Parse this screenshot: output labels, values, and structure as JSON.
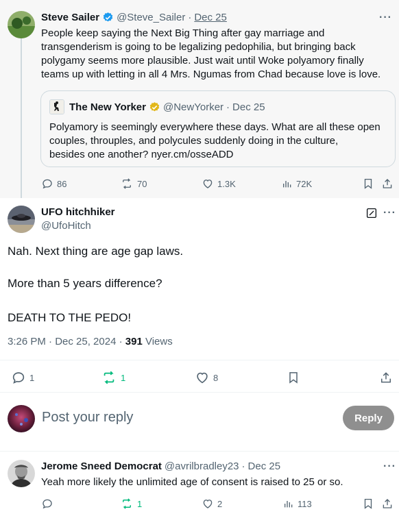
{
  "parent_tweet": {
    "author_name": "Steve Sailer",
    "handle": "@Steve_Sailer",
    "separator": "·",
    "date": "Dec 25",
    "text_lines": [
      "People keep saying the Next Big Thing after gay marriage and",
      "transgenderism is going to be legalizing pedophilia, but bringing back",
      "polygamy seems more plausible. Just wait until Woke polyamory finally",
      "teams up with letting in all 4 Mrs. Ngumas from Chad because love is love."
    ],
    "quote": {
      "author_name": "The New Yorker",
      "handle": "@NewYorker",
      "separator": "·",
      "date": "Dec 25",
      "text_lines": [
        "Polyamory is seemingly everywhere these days. What are all these open",
        "couples, throuples, and polycules suddenly doing in the culture,",
        "besides one another? nyer.cm/osseADD"
      ]
    },
    "stats": {
      "replies": "86",
      "reposts": "70",
      "likes": "1.3K",
      "views": "72K"
    }
  },
  "main_tweet": {
    "author_name": "UFO hitchhiker",
    "handle": "@UfoHitch",
    "text_lines": [
      "Nah. Next thing are age gap laws.",
      "More than 5 years difference?",
      "DEATH TO THE PEDO!"
    ],
    "timestamp": "3:26 PM · Dec 25, 2024 ·",
    "views_count": "391",
    "views_label": "Views",
    "stats": {
      "replies": "1",
      "reposts": "1",
      "likes": "8"
    }
  },
  "reply_composer": {
    "placeholder": "Post your reply",
    "button_label": "Reply"
  },
  "reply_tweet": {
    "author_name": "Jerome Sneed Democrat",
    "handle": "@avrilbradley23",
    "separator": "·",
    "date": "Dec 25",
    "text": "Yeah more likely the unlimited age of consent is raised to 25 or so.",
    "stats": {
      "reposts": "1",
      "likes": "2",
      "views": "113"
    }
  },
  "icons": {
    "more": "more-horizontal-icon",
    "verified_blue": "verified-badge-blue",
    "verified_gold": "verified-badge-gold"
  },
  "colors": {
    "text": "#0f1419",
    "secondary": "#536471",
    "verified_blue": "#1d9bf0",
    "verified_gold": "#e2b719",
    "repost_active": "#00ba7c",
    "reply_button": "#8f8f8f"
  }
}
